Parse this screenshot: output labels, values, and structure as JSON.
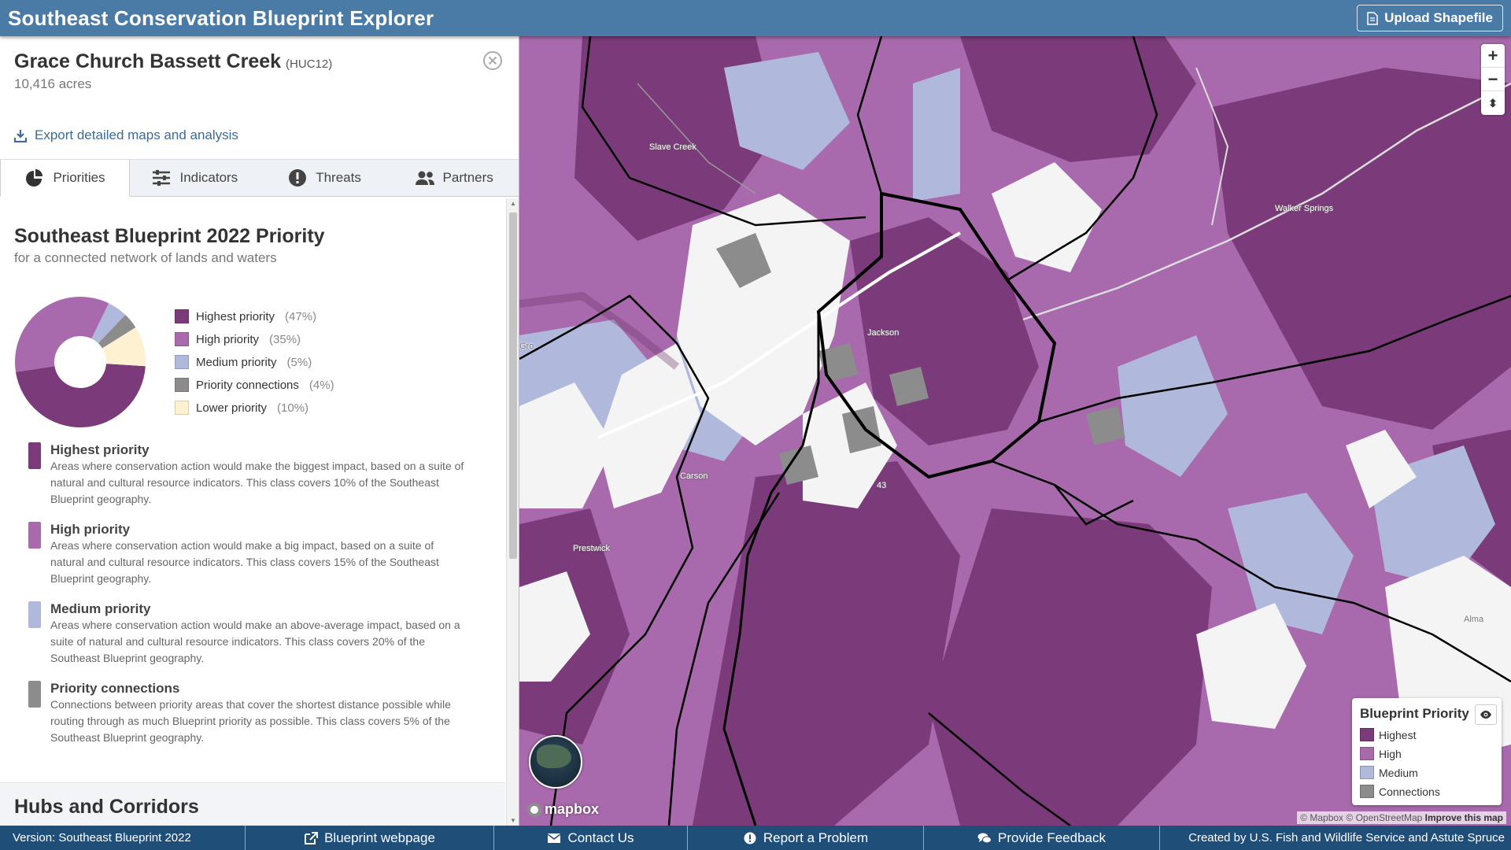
{
  "header": {
    "title": "Southeast  Conservation Blueprint Explorer",
    "upload_label": "Upload Shapefile"
  },
  "unit": {
    "name": "Grace Church Bassett Creek",
    "type": "(HUC12)",
    "acres": "10,416 acres",
    "export_label": "Export detailed maps and analysis"
  },
  "tabs": [
    {
      "label": "Priorities",
      "icon": "pie-chart-icon",
      "active": true
    },
    {
      "label": "Indicators",
      "icon": "sliders-icon",
      "active": false
    },
    {
      "label": "Threats",
      "icon": "exclamation-icon",
      "active": false
    },
    {
      "label": "Partners",
      "icon": "users-icon",
      "active": false
    }
  ],
  "priority_section": {
    "title": "Southeast Blueprint 2022 Priority",
    "subtitle": "for a connected network of lands and waters"
  },
  "chart_data": {
    "type": "pie",
    "categories": [
      "Highest priority",
      "High priority",
      "Medium priority",
      "Priority connections",
      "Lower priority"
    ],
    "values": [
      47,
      35,
      5,
      4,
      10
    ],
    "labels": [
      "(47%)",
      "(35%)",
      "(5%)",
      "(4%)",
      "(10%)"
    ],
    "colors": [
      "#7b3a79",
      "#a86aac",
      "#b0b8dc",
      "#8c8c8c",
      "#fdf1d2"
    ]
  },
  "definitions": [
    {
      "title": "Highest priority",
      "color": "#7b3a79",
      "text": "Areas where conservation action would make the biggest impact, based on a suite of natural and cultural resource indicators. This class covers 10% of the Southeast Blueprint geography."
    },
    {
      "title": "High priority",
      "color": "#a86aac",
      "text": "Areas where conservation action would make a big impact, based on a suite of natural and cultural resource indicators. This class covers 15% of the Southeast Blueprint geography."
    },
    {
      "title": "Medium priority",
      "color": "#b0b8dc",
      "text": "Areas where conservation action would make an above-average impact, based on a suite of natural and cultural resource indicators. This class covers 20% of the Southeast Blueprint geography."
    },
    {
      "title": "Priority connections",
      "color": "#8c8c8c",
      "text": "Connections between priority areas that cover the shortest distance possible while routing through as much Blueprint priority as possible. This class covers 5% of the Southeast Blueprint geography."
    }
  ],
  "hubs": {
    "title": "Hubs and Corridors"
  },
  "map": {
    "places": [
      "Slave Creek",
      "Walker Springs",
      "Jackson",
      "Carson",
      "Prestwick",
      "Alma",
      "Gro",
      "43"
    ],
    "legend": {
      "title": "Blueprint Priority",
      "items": [
        {
          "label": "Highest",
          "color": "#7b3a79"
        },
        {
          "label": "High",
          "color": "#a86aac"
        },
        {
          "label": "Medium",
          "color": "#b0b8dc"
        },
        {
          "label": "Connections",
          "color": "#8c8c8c"
        }
      ]
    },
    "zoom_in": "+",
    "zoom_out": "−",
    "compass": "⬍",
    "logo": "mapbox",
    "attribution": {
      "mapbox": "© Mapbox",
      "osm": "© OpenStreetMap",
      "improve": "Improve this map"
    }
  },
  "footer": {
    "version": "Version: Southeast Blueprint 2022",
    "blueprint": "Blueprint webpage",
    "contact": "Contact Us",
    "report": "Report a Problem",
    "feedback": "Provide Feedback",
    "credit": "Created by U.S. Fish and Wildlife Service and Astute Spruce"
  }
}
